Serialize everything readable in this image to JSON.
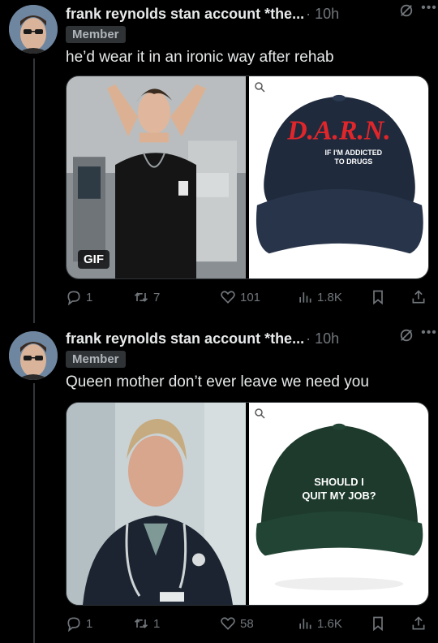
{
  "posts": [
    {
      "author": "frank reynolds stan account *the...",
      "time": "· 10h",
      "badge": "Member",
      "text": "he’d wear it in an ironic way after rehab",
      "media": {
        "left_label": "GIF",
        "cap_brand": "D.A.R.N.",
        "cap_line1": "IF I'M ADDICTED",
        "cap_line2": "TO DRUGS",
        "cap_color": "#1f2a3c"
      },
      "stats": {
        "replies": "1",
        "reposts": "7",
        "likes": "101",
        "views": "1.8K"
      }
    },
    {
      "author": "frank reynolds stan account *the...",
      "time": "· 10h",
      "badge": "Member",
      "text": "Queen mother don’t ever leave we need you",
      "media": {
        "cap_line1": "SHOULD I",
        "cap_line2": "QUIT MY JOB?",
        "cap_color": "#1d3a2c"
      },
      "stats": {
        "replies": "1",
        "reposts": "1",
        "likes": "58",
        "views": "1.6K"
      }
    }
  ],
  "icons": {
    "reply": "reply-icon",
    "repost": "repost-icon",
    "like": "heart-icon",
    "views": "views-icon",
    "bookmark": "bookmark-icon",
    "share": "share-icon",
    "grok": "grok-icon",
    "more": "more-icon",
    "zoom": "zoom-icon"
  },
  "colors": {
    "background": "#000000",
    "text_primary": "#e7e9ea",
    "text_secondary": "#71767b",
    "divider": "#2f3336"
  }
}
